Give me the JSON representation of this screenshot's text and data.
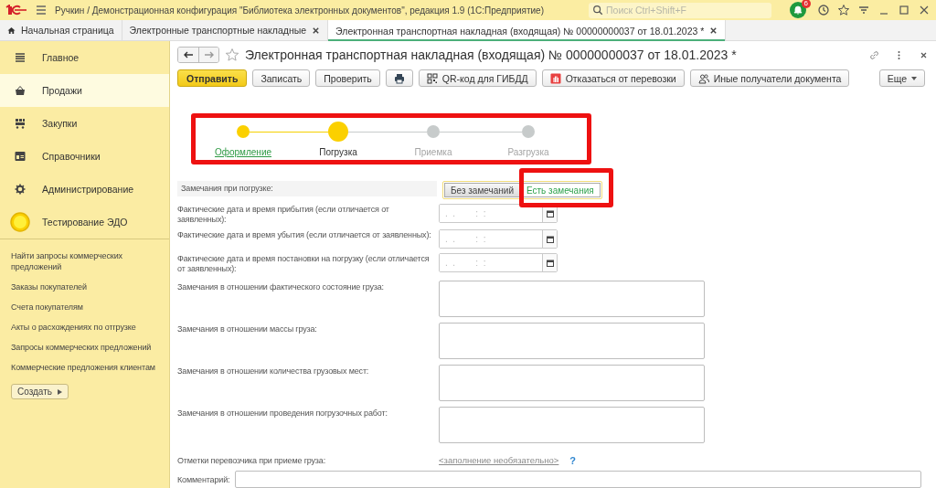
{
  "app_bar": {
    "title": "Ручкин / Демонстрационная конфигурация \"Библиотека электронных документов\", редакция 1.9  (1С:Предприятие)",
    "search": {
      "placeholder": "Поиск Ctrl+Shift+F"
    },
    "notifications_badge": "6"
  },
  "tabs": [
    {
      "label": "Начальная страница",
      "selected": false,
      "closable": false
    },
    {
      "label": "Электронные транспортные накладные",
      "selected": false,
      "closable": true
    },
    {
      "label": "Электронная транспортная накладная (входящая) № 00000000037 от 18.01.2023 *",
      "selected": true,
      "closable": true
    }
  ],
  "sidebar": {
    "sections": [
      {
        "label": "Главное",
        "selected": false
      },
      {
        "label": "Продажи",
        "selected": true
      },
      {
        "label": "Закупки",
        "selected": false
      },
      {
        "label": "Справочники",
        "selected": false
      },
      {
        "label": "Администрирование",
        "selected": false
      },
      {
        "label": "Тестирование ЭДО",
        "selected": false
      }
    ],
    "links": [
      "Найти запросы коммерческих предложений",
      "Заказы покупателей",
      "Счета покупателям",
      "Акты о расхождениях по отгрузке",
      "Запросы коммерческих предложений",
      "Коммерческие предложения клиентам"
    ],
    "create_button": "Создать"
  },
  "document": {
    "title": "Электронная транспортная накладная (входящая) № 00000000037 от 18.01.2023 *",
    "toolbar": [
      {
        "kind": "primary",
        "label": "Отправить"
      },
      {
        "kind": "plain",
        "label": "Записать"
      },
      {
        "kind": "plain",
        "label": "Проверить"
      },
      {
        "kind": "icon"
      },
      {
        "kind": "icon_text",
        "label": "QR-код для ГИБДД"
      },
      {
        "kind": "icon_text",
        "label": "Отказаться от перевозки"
      },
      {
        "kind": "icon_text",
        "label": "Иные получатели документа"
      }
    ],
    "more_button": "Еще",
    "stages": {
      "highlighted": true,
      "items": [
        {
          "label": "Оформление",
          "done": true,
          "current": false
        },
        {
          "label": "Погрузка",
          "done": false,
          "current": true
        },
        {
          "label": "Приемка",
          "done": false,
          "current": false
        },
        {
          "label": "Разгрузка",
          "done": false,
          "current": false
        }
      ]
    },
    "fields": [
      {
        "kind": "toggle",
        "label": "Замечания при погрузке:",
        "highlighted": true,
        "options": [
          {
            "label": "Без замечаний",
            "selected": false
          },
          {
            "label": "Есть замечания",
            "selected": true
          }
        ]
      },
      {
        "kind": "datetime",
        "label": "Фактические дата и время прибытия (если отличается от заявленных):",
        "placeholder": ".  .        :  :"
      },
      {
        "kind": "datetime",
        "label": "Фактические дата и время убытия (если отличается от заявленных):",
        "placeholder": ".  .        :  :"
      },
      {
        "kind": "datetime",
        "label": "Фактические дата и время постановки на погрузку (если отличается от заявленных):",
        "placeholder": ".  .        :  :"
      },
      {
        "kind": "textarea",
        "label": "Замечания в отношении фактического состояние груза:"
      },
      {
        "kind": "textarea",
        "label": "Замечания в отношении массы груза:"
      },
      {
        "kind": "textarea",
        "label": "Замечания в отношении количества грузовых мест:"
      },
      {
        "kind": "textarea",
        "label": "Замечания в отношении проведения погрузочных работ:"
      },
      {
        "kind": "link",
        "label": "Отметки перевозчика при приеме груза:",
        "link": "<заполнение необязательно>",
        "help": "?"
      },
      {
        "kind": "comment",
        "label": "Комментарий:"
      }
    ]
  }
}
